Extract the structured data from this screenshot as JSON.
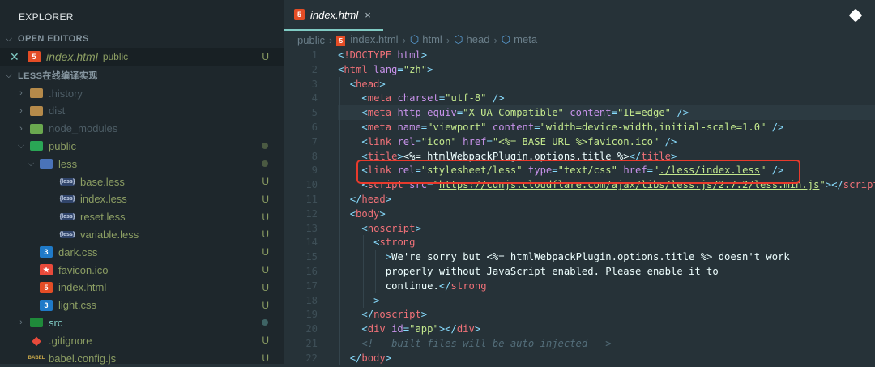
{
  "sidebar": {
    "title": "EXPLORER",
    "open_editors_label": "OPEN EDITORS",
    "open_editor": {
      "name": "index.html",
      "folder": "public",
      "status": "U"
    },
    "project_label": "LESS在线编译实现",
    "tree": [
      {
        "name": ".history",
        "depth": 0,
        "type": "folder",
        "expanded": false,
        "style": "dim",
        "status": ""
      },
      {
        "name": "dist",
        "depth": 0,
        "type": "folder",
        "expanded": false,
        "style": "dim",
        "status": ""
      },
      {
        "name": "node_modules",
        "depth": 0,
        "type": "folder",
        "expanded": false,
        "style": "dim",
        "status": ""
      },
      {
        "name": "public",
        "depth": 0,
        "type": "folder",
        "expanded": true,
        "style": "green",
        "status": "dot"
      },
      {
        "name": "less",
        "depth": 1,
        "type": "folder",
        "expanded": true,
        "style": "green",
        "status": "dot"
      },
      {
        "name": "base.less",
        "depth": 2,
        "type": "less",
        "style": "green",
        "status": "U"
      },
      {
        "name": "index.less",
        "depth": 2,
        "type": "less",
        "style": "green",
        "status": "U"
      },
      {
        "name": "reset.less",
        "depth": 2,
        "type": "less",
        "style": "green",
        "status": "U"
      },
      {
        "name": "variable.less",
        "depth": 2,
        "type": "less",
        "style": "green",
        "status": "U"
      },
      {
        "name": "dark.css",
        "depth": 1,
        "type": "css",
        "style": "green",
        "status": "U"
      },
      {
        "name": "favicon.ico",
        "depth": 1,
        "type": "ico",
        "style": "green",
        "status": "U"
      },
      {
        "name": "index.html",
        "depth": 1,
        "type": "html",
        "style": "green",
        "status": "U"
      },
      {
        "name": "light.css",
        "depth": 1,
        "type": "css",
        "style": "green",
        "status": "U"
      },
      {
        "name": "src",
        "depth": 0,
        "type": "folder",
        "expanded": false,
        "style": "teal",
        "status": "dot"
      },
      {
        "name": ".gitignore",
        "depth": 0,
        "type": "git",
        "style": "green",
        "status": "U"
      },
      {
        "name": "babel.config.js",
        "depth": 0,
        "type": "babel",
        "style": "green",
        "status": "U"
      }
    ]
  },
  "tab": {
    "label": "index.html",
    "close": "×"
  },
  "breadcrumb": [
    "public",
    "index.html",
    "html",
    "head",
    "meta"
  ],
  "code": [
    {
      "n": "1",
      "i": 0,
      "k": [
        [
          "p",
          "<"
        ],
        [
          "t",
          "!DOCTYPE"
        ],
        [
          "x",
          " "
        ],
        [
          "a",
          "html"
        ],
        [
          "p",
          ">"
        ]
      ]
    },
    {
      "n": "2",
      "i": 0,
      "k": [
        [
          "p",
          "<"
        ],
        [
          "t",
          "html"
        ],
        [
          "x",
          " "
        ],
        [
          "a",
          "lang"
        ],
        [
          "p",
          "="
        ],
        [
          "s",
          "\"zh\""
        ],
        [
          "p",
          ">"
        ]
      ]
    },
    {
      "n": "3",
      "i": 1,
      "k": [
        [
          "p",
          "<"
        ],
        [
          "t",
          "head"
        ],
        [
          "p",
          ">"
        ]
      ]
    },
    {
      "n": "4",
      "i": 2,
      "k": [
        [
          "p",
          "<"
        ],
        [
          "t",
          "meta"
        ],
        [
          "x",
          " "
        ],
        [
          "a",
          "charset"
        ],
        [
          "p",
          "="
        ],
        [
          "s",
          "\"utf-8\""
        ],
        [
          "x",
          " "
        ],
        [
          "p",
          "/>"
        ]
      ]
    },
    {
      "n": "5",
      "i": 2,
      "cur": true,
      "k": [
        [
          "p",
          "<"
        ],
        [
          "t",
          "meta"
        ],
        [
          "x",
          " "
        ],
        [
          "a",
          "http-equiv"
        ],
        [
          "p",
          "="
        ],
        [
          "s",
          "\"X-UA-Compatible\""
        ],
        [
          "x",
          " "
        ],
        [
          "a",
          "content"
        ],
        [
          "p",
          "="
        ],
        [
          "s",
          "\"IE=edge\""
        ],
        [
          "x",
          " "
        ],
        [
          "p",
          "/>"
        ]
      ]
    },
    {
      "n": "6",
      "i": 2,
      "k": [
        [
          "p",
          "<"
        ],
        [
          "t",
          "meta"
        ],
        [
          "x",
          " "
        ],
        [
          "a",
          "name"
        ],
        [
          "p",
          "="
        ],
        [
          "s",
          "\"viewport\""
        ],
        [
          "x",
          " "
        ],
        [
          "a",
          "content"
        ],
        [
          "p",
          "="
        ],
        [
          "s",
          "\"width=device-width,initial-scale=1.0\""
        ],
        [
          "x",
          " "
        ],
        [
          "p",
          "/>"
        ]
      ]
    },
    {
      "n": "7",
      "i": 2,
      "k": [
        [
          "p",
          "<"
        ],
        [
          "t",
          "link"
        ],
        [
          "x",
          " "
        ],
        [
          "a",
          "rel"
        ],
        [
          "p",
          "="
        ],
        [
          "s",
          "\"icon\""
        ],
        [
          "x",
          " "
        ],
        [
          "a",
          "href"
        ],
        [
          "p",
          "="
        ],
        [
          "s",
          "\"<%= BASE_URL %>favicon.ico\""
        ],
        [
          "x",
          " "
        ],
        [
          "p",
          "/>"
        ]
      ]
    },
    {
      "n": "8",
      "i": 2,
      "k": [
        [
          "p",
          "<"
        ],
        [
          "t",
          "title"
        ],
        [
          "p",
          ">"
        ],
        [
          "x",
          "<%= htmlWebpackPlugin.options.title %>"
        ],
        [
          "p",
          "</"
        ],
        [
          "t",
          "title"
        ],
        [
          "p",
          ">"
        ]
      ]
    },
    {
      "n": "9",
      "i": 2,
      "k": [
        [
          "p",
          "<"
        ],
        [
          "t",
          "link"
        ],
        [
          "x",
          " "
        ],
        [
          "a",
          "rel"
        ],
        [
          "p",
          "="
        ],
        [
          "s",
          "\"stylesheet/less\""
        ],
        [
          "x",
          " "
        ],
        [
          "a",
          "type"
        ],
        [
          "p",
          "="
        ],
        [
          "s",
          "\"text/css\""
        ],
        [
          "x",
          " "
        ],
        [
          "a",
          "href"
        ],
        [
          "p",
          "="
        ],
        [
          "s",
          "\""
        ],
        [
          "su",
          "./less/index.less"
        ],
        [
          "s",
          "\""
        ],
        [
          "x",
          " "
        ],
        [
          "p",
          "/>"
        ]
      ]
    },
    {
      "n": "10",
      "i": 2,
      "k": [
        [
          "p",
          "<"
        ],
        [
          "t",
          "script"
        ],
        [
          "x",
          " "
        ],
        [
          "a",
          "src"
        ],
        [
          "p",
          "="
        ],
        [
          "s",
          "\""
        ],
        [
          "su",
          "https://cdnjs.cloudflare.com/ajax/libs/less.js/2.7.2/less.min.js"
        ],
        [
          "s",
          "\""
        ],
        [
          "p",
          "></"
        ],
        [
          "t",
          "script"
        ],
        [
          "p",
          ">"
        ]
      ]
    },
    {
      "n": "11",
      "i": 1,
      "k": [
        [
          "p",
          "</"
        ],
        [
          "t",
          "head"
        ],
        [
          "p",
          ">"
        ]
      ]
    },
    {
      "n": "12",
      "i": 1,
      "k": [
        [
          "p",
          "<"
        ],
        [
          "t",
          "body"
        ],
        [
          "p",
          ">"
        ]
      ]
    },
    {
      "n": "13",
      "i": 2,
      "k": [
        [
          "p",
          "<"
        ],
        [
          "t",
          "noscript"
        ],
        [
          "p",
          ">"
        ]
      ]
    },
    {
      "n": "14",
      "i": 3,
      "k": [
        [
          "p",
          "<"
        ],
        [
          "t",
          "strong"
        ]
      ]
    },
    {
      "n": "15",
      "i": 4,
      "k": [
        [
          "p",
          ">"
        ],
        [
          "x",
          "We're sorry but <%= htmlWebpackPlugin.options.title %> doesn't work"
        ]
      ]
    },
    {
      "n": "16",
      "i": 4,
      "k": [
        [
          "x",
          "properly without JavaScript enabled. Please enable it to"
        ]
      ]
    },
    {
      "n": "17",
      "i": 4,
      "k": [
        [
          "x",
          "continue."
        ],
        [
          "p",
          "</"
        ],
        [
          "t",
          "strong"
        ]
      ]
    },
    {
      "n": "18",
      "i": 3,
      "k": [
        [
          "p",
          ">"
        ]
      ]
    },
    {
      "n": "19",
      "i": 2,
      "k": [
        [
          "p",
          "</"
        ],
        [
          "t",
          "noscript"
        ],
        [
          "p",
          ">"
        ]
      ]
    },
    {
      "n": "20",
      "i": 2,
      "k": [
        [
          "p",
          "<"
        ],
        [
          "t",
          "div"
        ],
        [
          "x",
          " "
        ],
        [
          "a",
          "id"
        ],
        [
          "p",
          "="
        ],
        [
          "s",
          "\"app\""
        ],
        [
          "p",
          "></"
        ],
        [
          "t",
          "div"
        ],
        [
          "p",
          ">"
        ]
      ]
    },
    {
      "n": "21",
      "i": 2,
      "k": [
        [
          "c",
          "<!-- built files will be auto injected -->"
        ]
      ]
    },
    {
      "n": "22",
      "i": 1,
      "k": [
        [
          "p",
          "</"
        ],
        [
          "t",
          "body"
        ],
        [
          "p",
          ">"
        ]
      ]
    }
  ],
  "highlight_line": "9"
}
